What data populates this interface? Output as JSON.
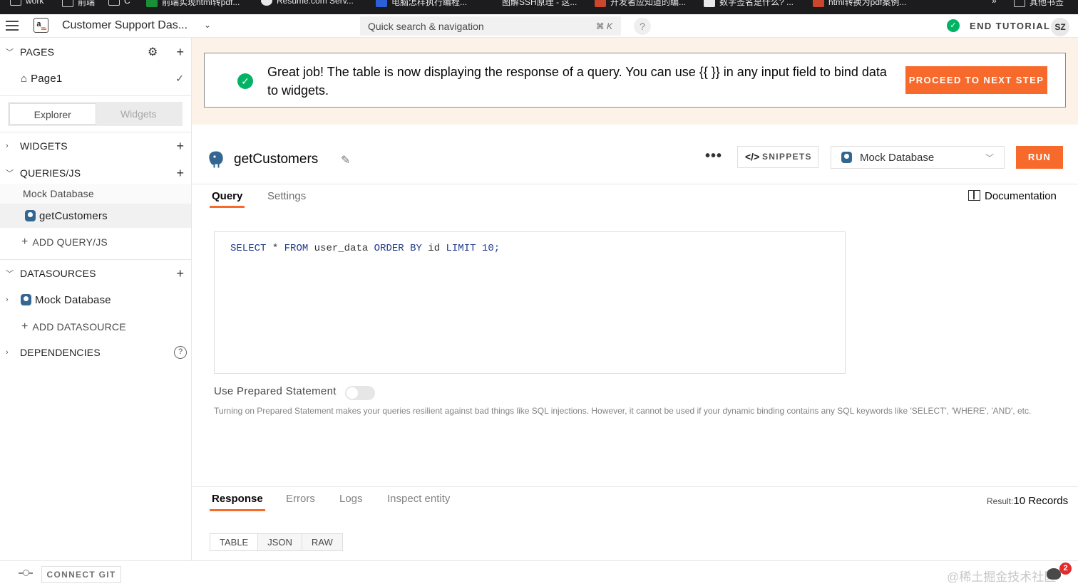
{
  "bookmarks": [
    {
      "label": "work",
      "color": "#9aa0a6"
    },
    {
      "label": "前端",
      "color": "#9aa0a6"
    },
    {
      "label": "C",
      "color": "#9aa0a6"
    },
    {
      "label": "前端实现html转pdf...",
      "color": "#1a8f3a"
    },
    {
      "label": "Resume.com Serv...",
      "color": "#e8e8e8"
    },
    {
      "label": "电脑怎样执行编程...",
      "color": "#2d5fd6"
    },
    {
      "label": "图解SSH原理 - 这...",
      "color": "#1c1c1e"
    },
    {
      "label": "开发者应知道的编...",
      "color": "#c8472d"
    },
    {
      "label": "数字签名是什么? ...",
      "color": "#e8e8e8"
    },
    {
      "label": "html转换为pdf案例...",
      "color": "#c8472d"
    },
    {
      "label": "»",
      "color": "#1c1c1e"
    },
    {
      "label": "其他书签",
      "color": "#9aa0a6"
    }
  ],
  "header": {
    "logo_text": "a_",
    "app_name": "Customer Support Das...",
    "app_chevron": "⌄",
    "search_placeholder": "Quick search & navigation",
    "search_shortcut": "⌘ K",
    "help": "?",
    "end_tutorial": "END TUTORIAL",
    "avatar": "SZ"
  },
  "sidebar": {
    "pages_title": "PAGES",
    "page1": "Page1",
    "tabs": [
      "Explorer",
      "Widgets"
    ],
    "widgets_title": "WIDGETS",
    "queries_title": "QUERIES/JS",
    "query_group": "Mock Database",
    "query_item": "getCustomers",
    "add_query": "ADD QUERY/JS",
    "datasources_title": "DATASOURCES",
    "datasource_item": "Mock Database",
    "add_datasource": "ADD DATASOURCE",
    "dependencies_title": "DEPENDENCIES",
    "icons": {
      "collapse": "chevron-down-icon",
      "expand": "chevron-right-icon",
      "settings": "gear-icon",
      "add": "plus-icon",
      "home": "home-icon",
      "check": "check-icon",
      "help": "help-circle-icon"
    }
  },
  "banner": {
    "message": "Great job! The table is now displaying the response of a query. You can use {{ }} in any input field to bind data to widgets.",
    "proceed": "PROCEED TO NEXT STEP"
  },
  "editor": {
    "query_name": "getCustomers",
    "more": "•••",
    "snippets_icon": "</>",
    "snippets": "SNIPPETS",
    "datasource": "Mock Database",
    "run": "RUN",
    "tabs": [
      "Query",
      "Settings"
    ],
    "documentation": "Documentation",
    "sql": {
      "kw1": "SELECT",
      "t1": " * ",
      "kw2": "FROM",
      "t2": " user_data ",
      "kw3": "ORDER BY",
      "t3": " id ",
      "kw4": "LIMIT",
      "t4": " 10;"
    },
    "prepared_label": "Use Prepared Statement",
    "prepared_enabled": false,
    "prepared_help": "Turning on Prepared Statement makes your queries resilient against bad things like SQL injections. However, it cannot be used if your dynamic binding contains any SQL keywords like 'SELECT', 'WHERE', 'AND', etc."
  },
  "response": {
    "tabs": [
      "Response",
      "Errors",
      "Logs",
      "Inspect entity"
    ],
    "result_prefix": "Result:",
    "result_value": "10 Records",
    "views": [
      "TABLE",
      "JSON",
      "RAW"
    ]
  },
  "footer": {
    "connect_git": "CONNECT GIT",
    "watermark": "@稀土掘金技术社区",
    "bug_count": "2"
  },
  "colors": {
    "accent": "#f86a2b",
    "success": "#03b365",
    "postgres": "#336791"
  }
}
